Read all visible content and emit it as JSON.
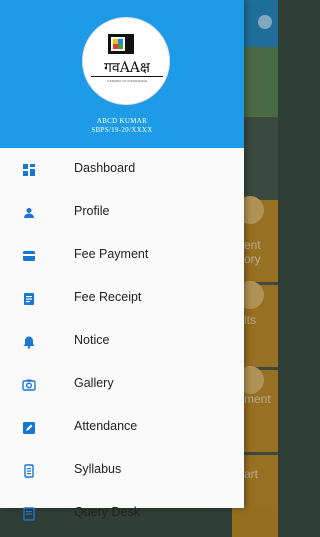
{
  "background": {
    "tiles": [
      {
        "name": "bg-tile-1",
        "label": "ent\nory"
      },
      {
        "name": "bg-tile-2",
        "label": "lts"
      },
      {
        "name": "bg-tile-3",
        "label": "ment"
      },
      {
        "name": "bg-tile-4",
        "label": "art"
      }
    ]
  },
  "drawer": {
    "header_color": "#1e9be6",
    "logo": {
      "text": "गवAAक्ष",
      "subtext": "GATEWAY OF KNOWLEDGE"
    },
    "user": {
      "name": "ABCD KUMAR",
      "id": "SBPS/19-20/XXXX"
    }
  },
  "menu": {
    "icon_color": "#1976d2",
    "items": [
      {
        "label": "Dashboard",
        "icon": "dashboard-icon"
      },
      {
        "label": "Profile",
        "icon": "person-icon"
      },
      {
        "label": "Fee Payment",
        "icon": "credit-card-icon"
      },
      {
        "label": "Fee Receipt",
        "icon": "receipt-icon"
      },
      {
        "label": "Notice",
        "icon": "bell-icon"
      },
      {
        "label": "Gallery",
        "icon": "camera-icon"
      },
      {
        "label": "Attendance",
        "icon": "edit-icon"
      },
      {
        "label": "Syllabus",
        "icon": "document-icon"
      },
      {
        "label": "Query Desk",
        "icon": "query-icon"
      }
    ]
  }
}
